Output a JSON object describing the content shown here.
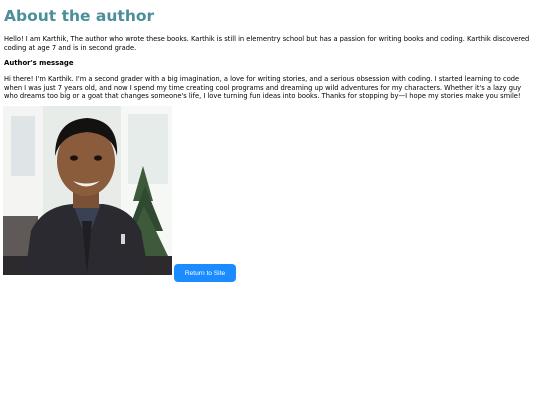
{
  "page": {
    "title": "About the author",
    "intro": "Hello! I am Karthik, The author who wrote these books. Karthik is still in elementry school but has a passion for writing books and coding. Karthik discovered coding at age 7 and is in second grade.",
    "message_heading": "Author's message",
    "message": "Hi there! I'm Karthik. I'm a second grader with a big imagination, a love for writing stories, and a serious obsession with coding. I started learning to code when I was just 7 years old, and now I spend my time creating cool programs and dreaming up wild adventures for my characters. Whether it's a lazy guy who dreams too big or a goat that changes someone's life, I love turning fun ideas into books. Thanks for stopping by—I hope my stories make you smile!",
    "return_button": "Return to Site"
  },
  "colors": {
    "title": "#4a8f9a",
    "button_bg": "#1a8cff",
    "button_text": "#ffffff"
  },
  "icons": {
    "author_photo": "author-photo"
  }
}
